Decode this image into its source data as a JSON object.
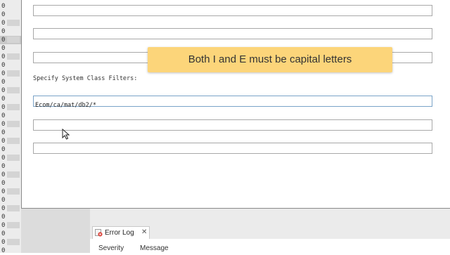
{
  "gutter": {
    "digits": [
      "0",
      "0",
      "0",
      "0",
      "0",
      "0",
      "0",
      "0",
      "0",
      "0",
      "0",
      "0",
      "0",
      "0",
      "0",
      "0",
      "0",
      "0",
      "0",
      "0",
      "0",
      "0",
      "0",
      "0",
      "0",
      "0",
      "0",
      "0",
      "0",
      "0"
    ]
  },
  "filters": {
    "label": "Specify System Class Filters:",
    "values": [
      "",
      "",
      "",
      "Ecom/ca/mat/db2/*",
      "",
      ""
    ]
  },
  "callout": {
    "text": "Both I and E must be capital letters",
    "color": "#fcd57a"
  },
  "error_log": {
    "tab_label": "Error Log",
    "tab_icon": "error-log-icon",
    "close_icon": "close-icon",
    "columns": [
      "Severity",
      "Message"
    ]
  }
}
